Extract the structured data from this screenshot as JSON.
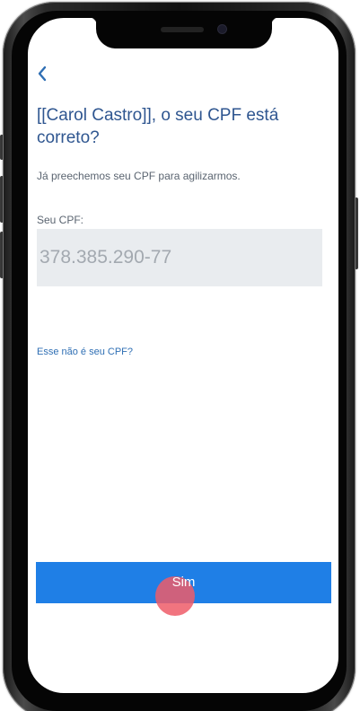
{
  "screen": {
    "back_icon": "chevron-left-icon",
    "title": "[[Carol Castro]], o seu CPF está correto?",
    "subtitle": "Já preechemos seu CPF para agilizarmos.",
    "cpf_label": "Seu CPF:",
    "cpf_value": "378.385.290-77",
    "not_your_cpf_link": "Esse não é seu CPF?",
    "confirm_button": "Sim"
  },
  "colors": {
    "accent": "#1f7fe6",
    "title": "#2f5690",
    "link": "#2f6fb4",
    "field_bg": "#e9ecef",
    "tap_indicator": "#ef5c68"
  }
}
